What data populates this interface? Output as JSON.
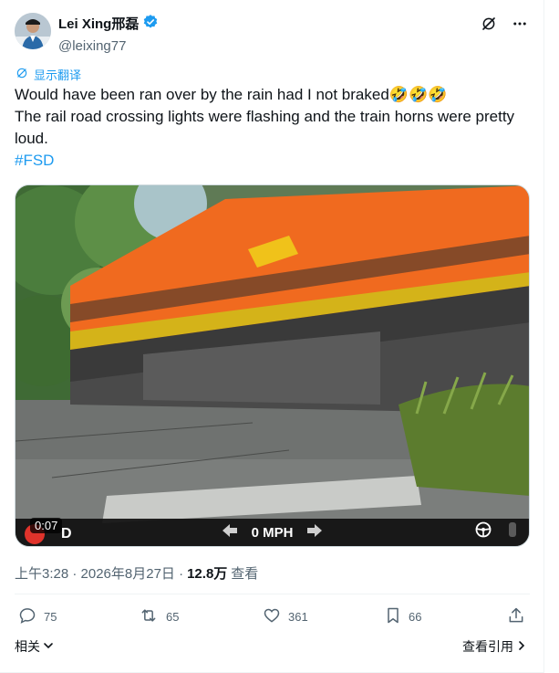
{
  "author": {
    "name": "Lei Xing邢磊",
    "handle": "@leixing77"
  },
  "translate_label": "显示翻译",
  "tweet": {
    "line1": "Would have been ran over by the rain had I not braked🤣🤣🤣",
    "line2": "The rail road crossing lights were flashing and the train horns were pretty loud.",
    "hashtag": "#FSD"
  },
  "video": {
    "elapsed": "0:07",
    "speed_label": "0 MPH",
    "side_letter": "D"
  },
  "meta": {
    "timestamp": "上午3:28 · 2026年8月27日 ·",
    "views_count": "12.8万",
    "views_label": "查看"
  },
  "actions": {
    "replies": "75",
    "reposts": "65",
    "likes": "361",
    "bookmarks": "66"
  },
  "footer": {
    "related_label": "相关",
    "quotes_label": "查看引用"
  },
  "colors": {
    "accent": "#1d9bf0",
    "verified": "#1d9bf0",
    "text": "#0f1419",
    "secondary": "#536471"
  }
}
